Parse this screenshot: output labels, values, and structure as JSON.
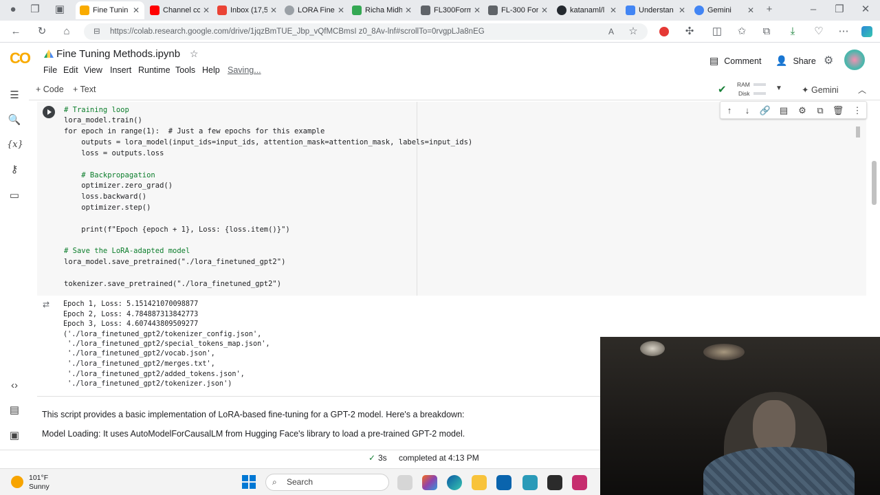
{
  "browser": {
    "tabs": [
      {
        "label": "Fine Tunin",
        "active": true,
        "color": "#f9ab00"
      },
      {
        "label": "Channel cc",
        "active": false,
        "color": "#ff0000"
      },
      {
        "label": "Inbox (17,5",
        "active": false,
        "color": "#ea4335"
      },
      {
        "label": "LORA Fine",
        "active": false,
        "color": "#5f6368"
      },
      {
        "label": "Richa Midh",
        "active": false,
        "color": "#34a853"
      },
      {
        "label": "FL300Form",
        "active": false,
        "color": "#5f6368"
      },
      {
        "label": "FL-300 For",
        "active": false,
        "color": "#5f6368"
      },
      {
        "label": "katanaml/l",
        "active": false,
        "color": "#24292f"
      },
      {
        "label": "Understan",
        "active": false,
        "color": "#4285f4"
      },
      {
        "label": "Gemini",
        "active": false,
        "color": "#4285f4"
      }
    ],
    "url": "https://colab.research.google.com/drive/1jqzBmTUE_Jbp_vQfMCBmsI z0_8Av-lnf#scrollTo=0rvgpLJa8nEG"
  },
  "colab": {
    "logo": "CO",
    "notebook_title": "Fine Tuning Methods.ipynb",
    "menu": [
      "File",
      "Edit",
      "View",
      "Insert",
      "Runtime",
      "Tools",
      "Help"
    ],
    "saving": "Saving...",
    "comment": "Comment",
    "share": "Share",
    "add_code": "+ Code",
    "add_text": "+ Text",
    "ram": "RAM",
    "disk": "Disk",
    "gemini": "Gemini"
  },
  "code_lines": [
    "# Training loop",
    "lora_model.train()",
    "for epoch in range(1):  # Just a few epochs for this example",
    "    outputs = lora_model(input_ids=input_ids, attention_mask=attention_mask, labels=input_ids)",
    "    loss = outputs.loss",
    "",
    "    # Backpropagation",
    "    optimizer.zero_grad()",
    "    loss.backward()",
    "    optimizer.step()",
    "",
    "    print(f\"Epoch {epoch + 1}, Loss: {loss.item()}\")",
    "",
    "# Save the LoRA-adapted model",
    "lora_model.save_pretrained(\"./lora_finetuned_gpt2\")",
    "",
    "tokenizer.save_pretrained(\"./lora_finetuned_gpt2\")"
  ],
  "output_lines": [
    "Epoch 1, Loss: 5.151421070098877",
    "Epoch 2, Loss: 4.784887313842773",
    "Epoch 3, Loss: 4.607443809509277",
    "('./lora_finetuned_gpt2/tokenizer_config.json',",
    " './lora_finetuned_gpt2/special_tokens_map.json',",
    " './lora_finetuned_gpt2/vocab.json',",
    " './lora_finetuned_gpt2/merges.txt',",
    " './lora_finetuned_gpt2/added_tokens.json',",
    " './lora_finetuned_gpt2/tokenizer.json')"
  ],
  "text_cell": [
    "This script provides a basic implementation of LoRA-based fine-tuning for a GPT-2 model. Here's a breakdown:",
    "Model Loading: It uses AutoModelForCausalLM from Hugging Face's library to load a pre-trained GPT-2 model."
  ],
  "status": {
    "duration": "3s",
    "completed": "completed at 4:13 PM"
  },
  "taskbar": {
    "temperature": "101°F",
    "condition": "Sunny",
    "search": "Search"
  },
  "colors": {
    "colab_orange": "#f9ab00",
    "comment_green": "#0b7d2b",
    "keyword_purple": "#7b1fa2",
    "check_green": "#188038"
  }
}
